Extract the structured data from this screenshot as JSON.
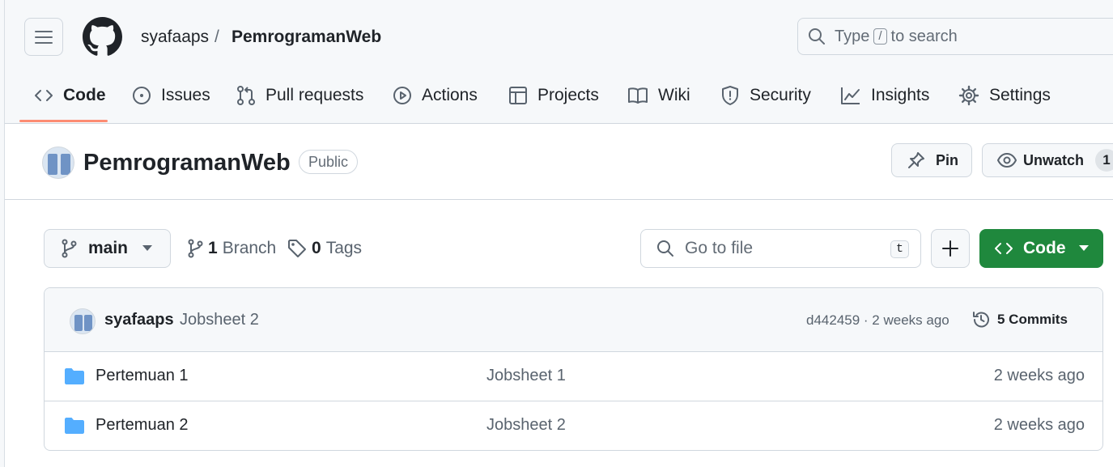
{
  "header": {
    "owner": "syafaaps",
    "separator": "/",
    "repo": "PemrogramanWeb",
    "search": {
      "before": "Type",
      "key": "/",
      "after": "to search"
    }
  },
  "tabs": [
    {
      "label": "Code",
      "icon": "code-icon",
      "selected": true
    },
    {
      "label": "Issues",
      "icon": "issue-icon"
    },
    {
      "label": "Pull requests",
      "icon": "pull-request-icon"
    },
    {
      "label": "Actions",
      "icon": "play-icon"
    },
    {
      "label": "Projects",
      "icon": "table-icon"
    },
    {
      "label": "Wiki",
      "icon": "book-icon"
    },
    {
      "label": "Security",
      "icon": "shield-icon"
    },
    {
      "label": "Insights",
      "icon": "graph-icon"
    },
    {
      "label": "Settings",
      "icon": "gear-icon"
    }
  ],
  "repo": {
    "title": "PemrogramanWeb",
    "visibility": "Public",
    "pin_label": "Pin",
    "watch_label": "Unwatch",
    "watch_count": "1"
  },
  "toolbar": {
    "branch": "main",
    "branch_count": "1",
    "branch_label": "Branch",
    "tag_count": "0",
    "tag_label": "Tags",
    "goto_placeholder": "Go to file",
    "goto_key": "t",
    "code_label": "Code"
  },
  "latest_commit": {
    "author": "syafaaps",
    "message": "Jobsheet 2",
    "meta": "d442459 · 2 weeks ago",
    "commits_label": "5 Commits"
  },
  "files": [
    {
      "name": "Pertemuan 1",
      "message": "Jobsheet 1",
      "time": "2 weeks ago",
      "icon": "folder-icon"
    },
    {
      "name": "Pertemuan 2",
      "message": "Jobsheet 2",
      "time": "2 weeks ago",
      "icon": "folder-icon"
    }
  ],
  "colors": {
    "accent_underline": "#fd8c73",
    "primary_button": "#1f883d",
    "folder": "#54aeff",
    "text": "#1f2328",
    "muted": "#59636e"
  }
}
